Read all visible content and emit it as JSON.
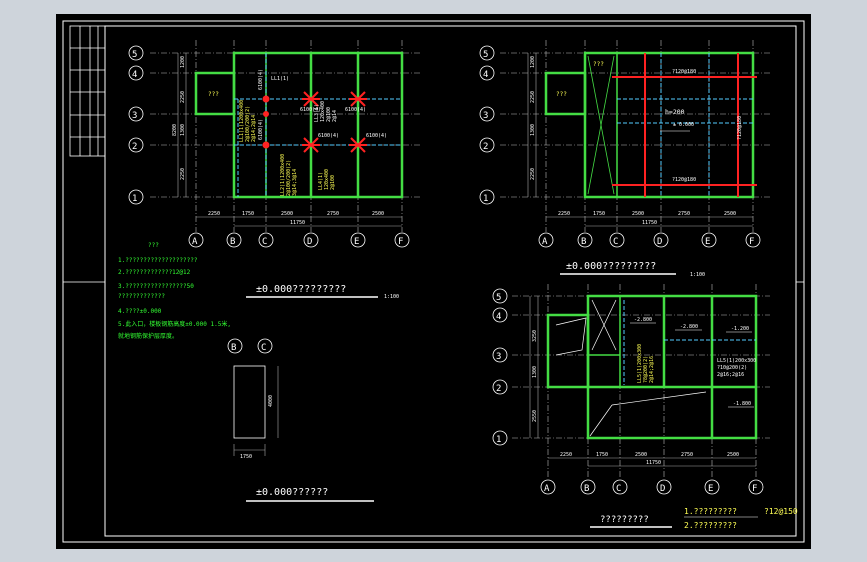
{
  "colors": {
    "app_bg": "#ced4db",
    "sheet_bg": "#000000",
    "frame": "#ffffff",
    "grid": "#d0d0d0",
    "wall": "#44dd44",
    "beam": "#55ccff",
    "rebar": "#ff2222",
    "note": "#ffff55",
    "note_green": "#33ff33"
  },
  "axes": {
    "rows": [
      "5",
      "4",
      "3",
      "2",
      "1"
    ],
    "cols": [
      "A",
      "B",
      "C",
      "D",
      "E",
      "F"
    ],
    "row_dims_plan1": [
      "1200",
      "2250",
      "1300",
      "2250"
    ],
    "row_dims_plan2": [
      "1200",
      "2250",
      "1300",
      "2250"
    ],
    "row_dims_plan3": [
      "3250",
      "1300",
      "2550"
    ],
    "row_total_plan1": "8200",
    "row_total_plan3": "8200",
    "col_dims": [
      "2250",
      "1750",
      "2500",
      "2750",
      "2500"
    ],
    "col_total": "11750"
  },
  "plan1": {
    "room_label": "???",
    "beam_labels": [
      "LL1(1)",
      "6100(4)",
      "6100(4)",
      "6100(4)",
      "6100(4)",
      "6100(4)",
      "6100(4)"
    ],
    "vert_notes_a": [
      "LL1(1)1200x400",
      "2@100/200(2)",
      "2@14;2@14"
    ],
    "vert_notes_b": [
      "LL2(1)1200x400",
      "2@100/200(2)",
      "3@14;3@14"
    ],
    "vert_notes_c": [
      "LL3(1)",
      "120x400",
      "2@100",
      "2@14"
    ],
    "vert_notes_d": [
      "LL4(1)",
      "120x400",
      "2@100"
    ],
    "title": "±0.000?????????",
    "scale": "1:100"
  },
  "plan2": {
    "room_label": "???",
    "rebar_top": "?120@180",
    "slab_h": "h=200",
    "elev": "± 0.000",
    "rebar_bottom": "?120@180",
    "rebar_right": "?120@180",
    "title": "±0.000?????????",
    "scale": "1:100"
  },
  "plan3": {
    "elev_a": "-2.800",
    "elev_b": "-2.800",
    "elev_c": "-1.200",
    "elev_d": "-1.800",
    "note_vert": [
      "LL5(1)200x300",
      "?8@200(2)",
      "2@14;2@16"
    ],
    "note_right": [
      "LL5(1)200x300",
      "?10@200(2)",
      "2@16;2@16"
    ],
    "title": "?????????",
    "note1": "1.?????????",
    "note2": "2.?????????",
    "note3": "?12@150"
  },
  "notes": {
    "heading": "???",
    "lines": [
      "1.????????????????????",
      "2.?????????????12@12",
      "3.?????????????????50",
      "  ?????????????",
      "4.????±0.000",
      "5.此入口，楼板钢筋高度±0.000 1.5米,",
      "  就地钢筋保护层厚度。"
    ]
  },
  "detail": {
    "axis_b": "B",
    "axis_c": "C",
    "height": "4000",
    "width": "1750",
    "title": "±0.000??????"
  }
}
